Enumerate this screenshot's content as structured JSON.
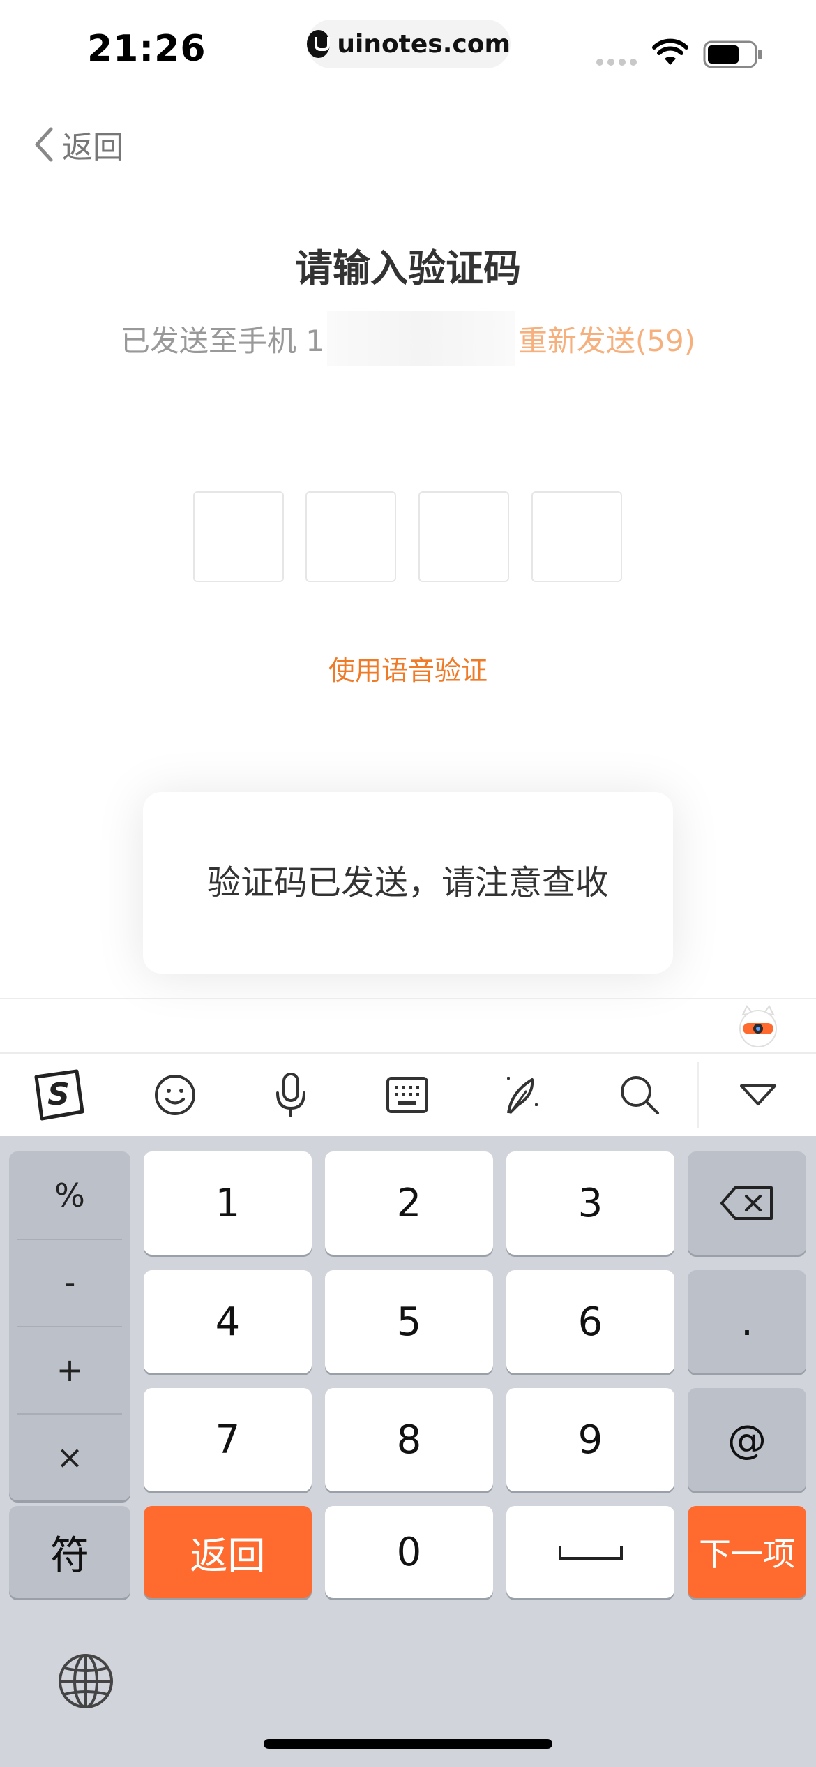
{
  "status_bar": {
    "time": "21:26",
    "url": "uinotes.com"
  },
  "nav": {
    "back_label": "返回"
  },
  "verify": {
    "title": "请输入验证码",
    "sent_prefix": "已发送至手机 1",
    "resend_label": "重新发送(59)",
    "code_length": 4,
    "voice_label": "使用语音验证"
  },
  "toast": {
    "message": "验证码已发送，请注意查收"
  },
  "keyboard": {
    "toolbar_icons": [
      "sogou-logo-icon",
      "emoji-icon",
      "microphone-icon",
      "keyboard-icon",
      "handwriting-icon",
      "search-icon",
      "collapse-icon"
    ],
    "symbols": [
      "%",
      "-",
      "+",
      "×"
    ],
    "digits": [
      "1",
      "2",
      "3",
      "4",
      "5",
      "6",
      "7",
      "8",
      "9",
      "0"
    ],
    "dot": ".",
    "at": "@",
    "symbol_key": "符",
    "return_key": "返回",
    "next_key": "下一项"
  },
  "colors": {
    "accent_orange": "#ff6a2f",
    "resend_orange": "#f6b07d",
    "link_orange": "#ef7a28"
  }
}
